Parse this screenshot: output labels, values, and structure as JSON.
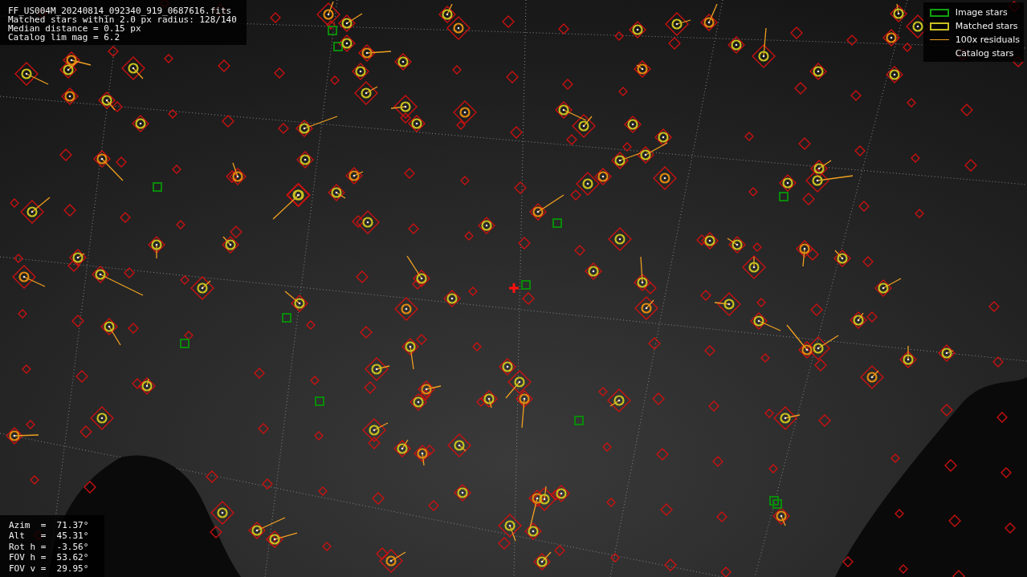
{
  "info_panel": {
    "lines": [
      "FF_US004M_20240814_092340_919_0687616.fits",
      "Matched stars within 2.0 px radius: 128/140",
      "Median distance = 0.15 px",
      "Catalog lim mag = 6.2"
    ]
  },
  "legend": {
    "items": [
      {
        "kind": "image",
        "label": "Image stars"
      },
      {
        "kind": "matched",
        "label": "Matched stars"
      },
      {
        "kind": "residual",
        "label": "100x residuals"
      },
      {
        "kind": "catalog",
        "label": "Catalog stars"
      }
    ]
  },
  "pointing_panel": {
    "lines": [
      "Azim  =  71.37°",
      "Alt   =  45.31°",
      "Rot h =  -3.56°",
      "FOV h =  53.62°",
      "FOV v =  29.95°"
    ]
  }
}
